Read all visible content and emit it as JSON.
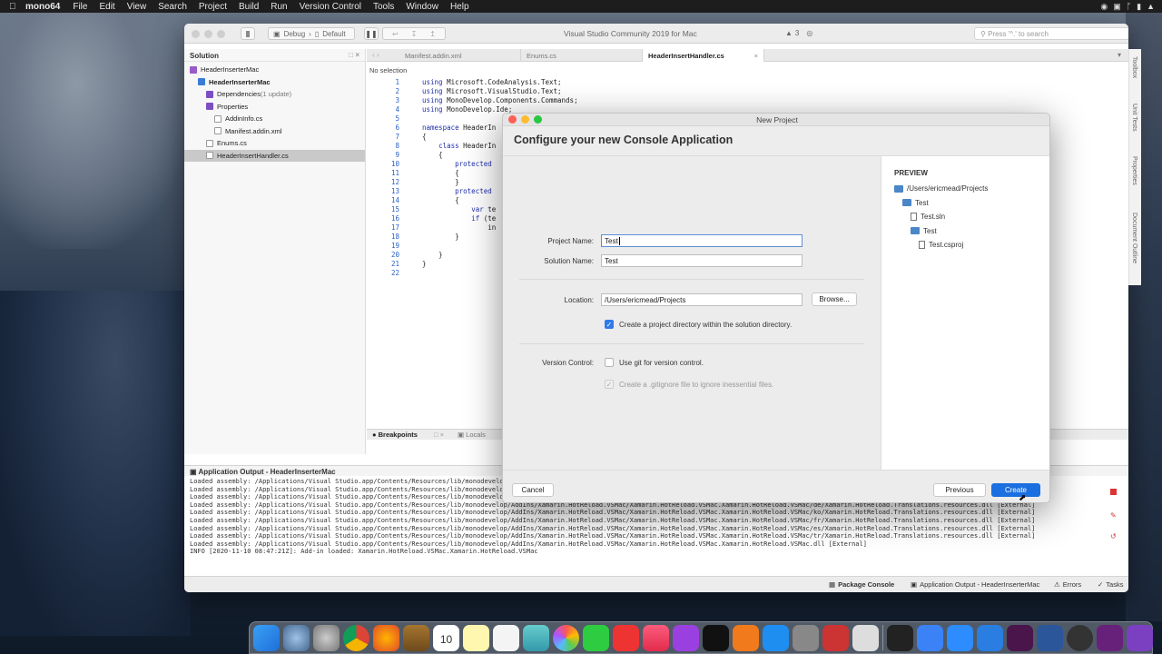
{
  "menubar": {
    "app": "mono64",
    "items": [
      "File",
      "Edit",
      "View",
      "Search",
      "Project",
      "Build",
      "Run",
      "Version Control",
      "Tools",
      "Window",
      "Help"
    ]
  },
  "ide": {
    "title": "Visual Studio Community 2019 for Mac",
    "config": "Debug",
    "target": "Default",
    "warnings": "3",
    "search_placeholder": "Press '^.' to search",
    "solution_header": "Solution",
    "tree": [
      {
        "label": "HeaderInserterMac",
        "bold": false,
        "indent": 0,
        "icon": "solution"
      },
      {
        "label": "HeaderInserterMac",
        "bold": true,
        "indent": 1,
        "icon": "project"
      },
      {
        "label": "Dependencies",
        "suffix": " (1 update)",
        "indent": 2,
        "icon": "folder"
      },
      {
        "label": "Properties",
        "indent": 2,
        "icon": "folder"
      },
      {
        "label": "AddinInfo.cs",
        "indent": 3,
        "icon": "file"
      },
      {
        "label": "Manifest.addin.xml",
        "indent": 3,
        "icon": "file"
      },
      {
        "label": "Enums.cs",
        "indent": 2,
        "icon": "file"
      },
      {
        "label": "HeaderInsertHandler.cs",
        "indent": 2,
        "icon": "file",
        "selected": true
      }
    ],
    "tabs": [
      "Manifest.addin.xml",
      "Enums.cs",
      "HeaderInsertHandler.cs"
    ],
    "active_tab": 2,
    "no_selection": "No selection",
    "code_lines": [
      "using Microsoft.CodeAnalysis.Text;",
      "using Microsoft.VisualStudio.Text;",
      "using MonoDevelop.Components.Commands;",
      "using MonoDevelop.Ide;",
      "",
      "namespace HeaderIn",
      "{",
      "    class HeaderIn",
      "    {",
      "        protected",
      "        {",
      "        }",
      "        protected",
      "        {",
      "            var te",
      "            if (te",
      "                in",
      "        }",
      "",
      "    }",
      "}",
      ""
    ],
    "pads": {
      "breakpoints": "Breakpoints",
      "locals": "Locals"
    },
    "output_title": "Application Output - HeaderInserterMac",
    "output_lines": [
      "Loaded assembly: /Applications/Visual Studio.app/Contents/Resources/lib/monodevelop/AddIns/Xamarin.HotReload.VSMac/Xamarin.HotReload.VSMac.Xamarin.HotReload.VSMac/Xamarin.HotReload.Translations.resources.dll [External]",
      "Loaded assembly: /Applications/Visual Studio.app/Contents/Resources/lib/monodevelop/AddIns/Xamarin.HotReload.VSMac/Xamarin.HotReload.VSMac.Xamarin.HotReload.VSMac/Xamarin.HotReload.Translations.resources.dll [External]",
      "Loaded assembly: /Applications/Visual Studio.app/Contents/Resources/lib/monodevelop/AddIns/Xamarin.HotReload.VSMac/Xamarin.HotReload.VSMac.Xamarin.HotReload.VSMac/Xamarin.HotReload.Translations.resources.dll [External]",
      "Loaded assembly: /Applications/Visual Studio.app/Contents/Resources/lib/monodevelop/AddIns/Xamarin.HotReload.VSMac/Xamarin.HotReload.VSMac.Xamarin.HotReload.VSMac/de/Xamarin.HotReload.Translations.resources.dll [External]",
      "Loaded assembly: /Applications/Visual Studio.app/Contents/Resources/lib/monodevelop/AddIns/Xamarin.HotReload.VSMac/Xamarin.HotReload.VSMac.Xamarin.HotReload.VSMac/ko/Xamarin.HotReload.Translations.resources.dll [External]",
      "Loaded assembly: /Applications/Visual Studio.app/Contents/Resources/lib/monodevelop/AddIns/Xamarin.HotReload.VSMac/Xamarin.HotReload.VSMac.Xamarin.HotReload.VSMac/fr/Xamarin.HotReload.Translations.resources.dll [External]",
      "Loaded assembly: /Applications/Visual Studio.app/Contents/Resources/lib/monodevelop/AddIns/Xamarin.HotReload.VSMac/Xamarin.HotReload.VSMac.Xamarin.HotReload.VSMac/es/Xamarin.HotReload.Translations.resources.dll [External]",
      "Loaded assembly: /Applications/Visual Studio.app/Contents/Resources/lib/monodevelop/AddIns/Xamarin.HotReload.VSMac/Xamarin.HotReload.VSMac.Xamarin.HotReload.VSMac/tr/Xamarin.HotReload.Translations.resources.dll [External]",
      "Loaded assembly: /Applications/Visual Studio.app/Contents/Resources/lib/monodevelop/AddIns/Xamarin.HotReload.VSMac/Xamarin.HotReload.VSMac.Xamarin.HotReload.VSMac.dll [External]",
      "INFO [2020-11-10 08:47:21Z]: Add-in loaded: Xamarin.HotReload.VSMac.Xamarin.HotReload.VSMac"
    ],
    "status": {
      "package_console": "Package Console",
      "app_output": "Application Output - HeaderInserterMac",
      "errors": "Errors",
      "tasks": "Tasks"
    },
    "right_pads": [
      "Toolbox",
      "Unit Tests",
      "Properties",
      "Document Outline"
    ]
  },
  "dialog": {
    "window_title": "New Project",
    "heading": "Configure your new Console Application",
    "project_name_label": "Project Name:",
    "project_name": "Test",
    "solution_name_label": "Solution Name:",
    "solution_name": "Test",
    "location_label": "Location:",
    "location": "/Users/ericmead/Projects",
    "browse": "Browse...",
    "create_dir": "Create a project directory within the solution directory.",
    "version_control_label": "Version Control:",
    "use_git": "Use git for version control.",
    "gitignore": "Create a .gitignore file to ignore inessential files.",
    "preview_title": "PREVIEW",
    "preview": [
      {
        "label": "/Users/ericmead/Projects",
        "type": "folder",
        "indent": 0
      },
      {
        "label": "Test",
        "type": "folder",
        "indent": 1
      },
      {
        "label": "Test.sln",
        "type": "file",
        "indent": 2
      },
      {
        "label": "Test",
        "type": "folder",
        "indent": 2
      },
      {
        "label": "Test.csproj",
        "type": "file",
        "indent": 3
      }
    ],
    "cancel": "Cancel",
    "previous": "Previous",
    "create": "Create"
  },
  "dock": {
    "calendar_day": "10"
  },
  "colors": {
    "accent": "#1b6fe0",
    "selection": "#c9c9c9",
    "keyword": "#1d2fa8"
  }
}
